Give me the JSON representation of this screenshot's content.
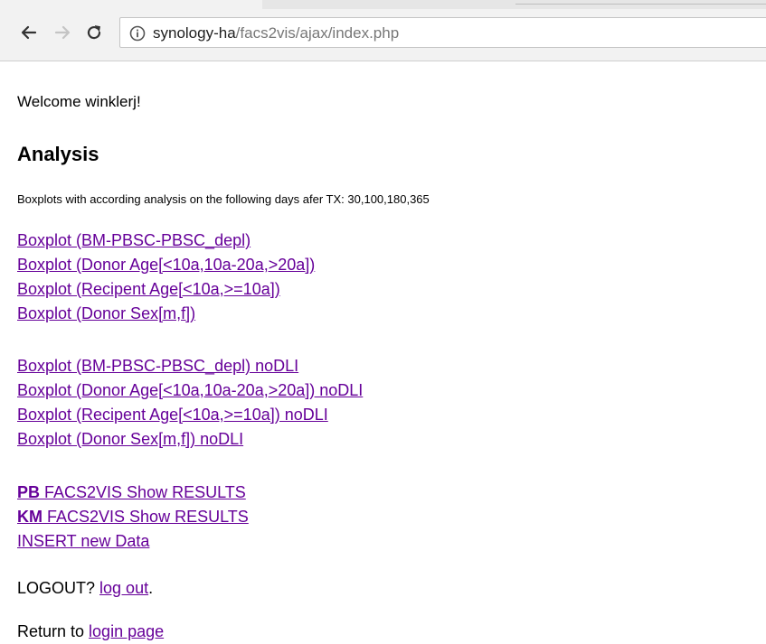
{
  "browser": {
    "url_host": "synology-ha",
    "url_path": "/facs2vis/ajax/index.php",
    "icons": [
      "back-arrow-icon",
      "forward-arrow-icon",
      "reload-icon",
      "info-icon"
    ]
  },
  "page": {
    "welcome": "Welcome winklerj!",
    "heading": "Analysis",
    "description": "Boxplots with according analysis on the following days afer TX: 30,100,180,365",
    "boxplots": [
      "Boxplot (BM-PBSC-PBSC_depl)",
      "Boxplot (Donor Age[<10a,10a-20a,>20a])",
      "Boxplot (Recipent Age[<10a,>=10a])",
      "Boxplot (Donor Sex[m,f])"
    ],
    "boxplots_nodli": [
      "Boxplot (BM-PBSC-PBSC_depl) noDLI",
      "Boxplot (Donor Age[<10a,10a-20a,>20a]) noDLI",
      "Boxplot (Recipent Age[<10a,>=10a]) noDLI",
      "Boxplot (Donor Sex[m,f]) noDLI"
    ],
    "results": [
      {
        "prefix": "PB",
        "label": " FACS2VIS Show RESULTS"
      },
      {
        "prefix": "KM",
        "label": " FACS2VIS Show RESULTS"
      }
    ],
    "insert_link": "INSERT new Data",
    "logout_text": "LOGOUT? ",
    "logout_link": "log out",
    "logout_suffix": ".",
    "return_text": "Return to ",
    "return_link": "login page"
  },
  "colors": {
    "link": "#660099",
    "toolbar": "#f2f2f2"
  }
}
